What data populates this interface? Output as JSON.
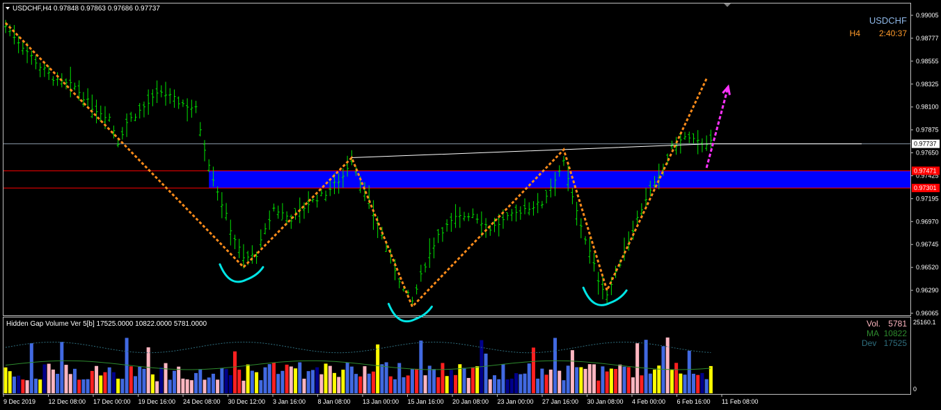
{
  "window": {
    "header": "USDCHF,H4  0.97848 0.97863 0.97686 0.97737",
    "symbol": "USDCHF",
    "timeframe": "H4",
    "countdown": "2:40:37",
    "colors": {
      "background": "#000000",
      "candle": "#00e600",
      "grid": "#c0c0c0",
      "zone": "#0000ff",
      "zone_edge": "#ff0000",
      "trend": "#ff8c1a",
      "arrow": "#ff33ff",
      "curve": "#00e5e5",
      "volume_blue": "#4169e1",
      "volume_pink": "#ffb6c1",
      "volume_red": "#ff2020",
      "volume_navy": "#00008b",
      "volume_yellow": "#ffff00"
    }
  },
  "chart_data": [
    {
      "type": "line",
      "title": "USDCHF,H4",
      "ylim": [
        0.96065,
        0.99005
      ],
      "y_ticks": [
        "0.99005",
        "0.98777",
        "0.98555",
        "0.98325",
        "0.98100",
        "0.97875",
        "0.97650",
        "0.97425",
        "0.97195",
        "0.96970",
        "0.96745",
        "0.96520",
        "0.96290",
        "0.96065"
      ],
      "x_ticks": [
        "9 Dec 2019",
        "12 Dec 08:00",
        "17 Dec 00:00",
        "19 Dec 16:00",
        "24 Dec 08:00",
        "30 Dec 12:00",
        "3 Jan 16:00",
        "8 Jan 08:00",
        "13 Jan 00:00",
        "15 Jan 16:00",
        "20 Jan 08:00",
        "23 Jan 00:00",
        "27 Jan 16:00",
        "30 Jan 08:00",
        "4 Feb 00:00",
        "6 Feb 16:00",
        "11 Feb 08:00"
      ],
      "price_path": [
        [
          0,
          0.989
        ],
        [
          4,
          0.987
        ],
        [
          8,
          0.985
        ],
        [
          12,
          0.9835
        ],
        [
          16,
          0.983
        ],
        [
          20,
          0.981
        ],
        [
          24,
          0.98
        ],
        [
          26,
          0.9775
        ],
        [
          28,
          0.9795
        ],
        [
          32,
          0.981
        ],
        [
          36,
          0.9825
        ],
        [
          40,
          0.9815
        ],
        [
          44,
          0.9808
        ],
        [
          46,
          0.977
        ],
        [
          48,
          0.974
        ],
        [
          52,
          0.969
        ],
        [
          55,
          0.966
        ],
        [
          58,
          0.9665
        ],
        [
          62,
          0.971
        ],
        [
          66,
          0.97
        ],
        [
          70,
          0.9715
        ],
        [
          74,
          0.9725
        ],
        [
          78,
          0.9742
        ],
        [
          80,
          0.976
        ],
        [
          83,
          0.9725
        ],
        [
          86,
          0.9695
        ],
        [
          89,
          0.966
        ],
        [
          92,
          0.963
        ],
        [
          94,
          0.9618
        ],
        [
          97,
          0.9655
        ],
        [
          100,
          0.9685
        ],
        [
          104,
          0.97
        ],
        [
          108,
          0.9705
        ],
        [
          112,
          0.969
        ],
        [
          116,
          0.97
        ],
        [
          120,
          0.971
        ],
        [
          124,
          0.9715
        ],
        [
          127,
          0.974
        ],
        [
          129,
          0.9755
        ],
        [
          131,
          0.972
        ],
        [
          134,
          0.968
        ],
        [
          137,
          0.964
        ],
        [
          139,
          0.9625
        ],
        [
          141,
          0.9645
        ],
        [
          145,
          0.969
        ],
        [
          148,
          0.972
        ],
        [
          151,
          0.974
        ],
        [
          154,
          0.977
        ],
        [
          157,
          0.978
        ],
        [
          160,
          0.9775
        ],
        [
          163,
          0.9775
        ]
      ],
      "x_range": [
        0,
        166
      ],
      "resistance_zone": {
        "top": 0.97471,
        "bottom": 0.97301,
        "top_label": "0.97471",
        "bottom_label": "0.97301"
      },
      "current_price": {
        "value": 0.97737,
        "label": "0.97737"
      },
      "neckline": [
        [
          80,
          0.976
        ],
        [
          129,
          0.9768
        ],
        [
          163,
          0.97737
        ]
      ],
      "pattern_lines": [
        [
          [
            0,
            0.9893
          ],
          [
            55,
            0.9652
          ],
          [
            80,
            0.976
          ],
          [
            94,
            0.9613
          ],
          [
            129,
            0.9768
          ],
          [
            139,
            0.9629
          ],
          [
            162,
            0.9838
          ]
        ]
      ],
      "projection_arrow": [
        [
          162,
          0.975
        ],
        [
          167,
          0.983
        ]
      ],
      "troughs": [
        [
          55,
          0.9652
        ],
        [
          94,
          0.9613
        ],
        [
          139,
          0.9629
        ]
      ]
    },
    {
      "type": "bar",
      "title": "Hidden Gap Volume Ver 5[b] 17525.0000 10822.0000 5781.0000",
      "ylim": [
        0,
        25160.1
      ],
      "y_ticks": [
        "25160.1",
        "0"
      ],
      "legend": [
        {
          "name": "Vol.",
          "value": "5781"
        },
        {
          "name": "MA",
          "value": "10822"
        },
        {
          "name": "Dev",
          "value": "17525"
        }
      ],
      "bar_count": 166
    }
  ]
}
